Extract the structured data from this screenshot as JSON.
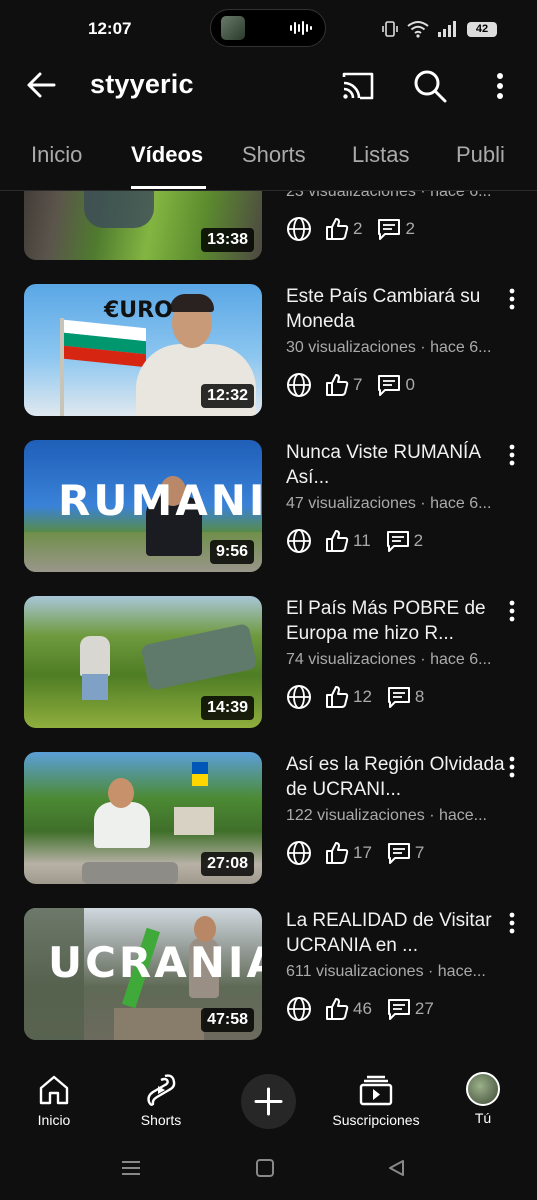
{
  "status_bar": {
    "time": "12:07",
    "battery": "42"
  },
  "app_bar": {
    "channel_name": "styyeric"
  },
  "tabs": [
    {
      "label": "Inicio"
    },
    {
      "label": "Vídeos"
    },
    {
      "label": "Shorts"
    },
    {
      "label": "Listas"
    },
    {
      "label": "Publi"
    }
  ],
  "videos": [
    {
      "title": "",
      "meta": "23 visualizaciones · hace 6...",
      "duration": "13:38",
      "likes": "2",
      "comments": "2"
    },
    {
      "title": "Este País Cambiará su Moneda",
      "meta": "30 visualizaciones · hace 6...",
      "duration": "12:32",
      "likes": "7",
      "comments": "0",
      "thumb_text": "€URO"
    },
    {
      "title": "Nunca Viste RUMANÍA Así...",
      "meta": "47 visualizaciones · hace 6...",
      "duration": "9:56",
      "likes": "11",
      "comments": "2",
      "thumb_text": "RUMANIA"
    },
    {
      "title": "El País Más POBRE de Europa me hizo R...",
      "meta": "74 visualizaciones · hace 6...",
      "duration": "14:39",
      "likes": "12",
      "comments": "8"
    },
    {
      "title": "Así es la Región Olvidada de UCRANI...",
      "meta": "122 visualizaciones · hace...",
      "duration": "27:08",
      "likes": "17",
      "comments": "7"
    },
    {
      "title": "La REALIDAD de Visitar UCRANIA en ...",
      "meta": "611 visualizaciones · hace...",
      "duration": "47:58",
      "likes": "46",
      "comments": "27",
      "thumb_text": "UCRANIA"
    }
  ],
  "bottom_nav": [
    {
      "label": "Inicio",
      "icon": "home-icon"
    },
    {
      "label": "Shorts",
      "icon": "shorts-icon"
    },
    {
      "label": "",
      "icon": "plus-icon"
    },
    {
      "label": "Suscripciones",
      "icon": "subscriptions-icon"
    },
    {
      "label": "Tú",
      "icon": "avatar"
    }
  ],
  "colors": {
    "background": "#0f0f0f",
    "text": "#ffffff",
    "secondary_text": "#aaaaaa"
  }
}
